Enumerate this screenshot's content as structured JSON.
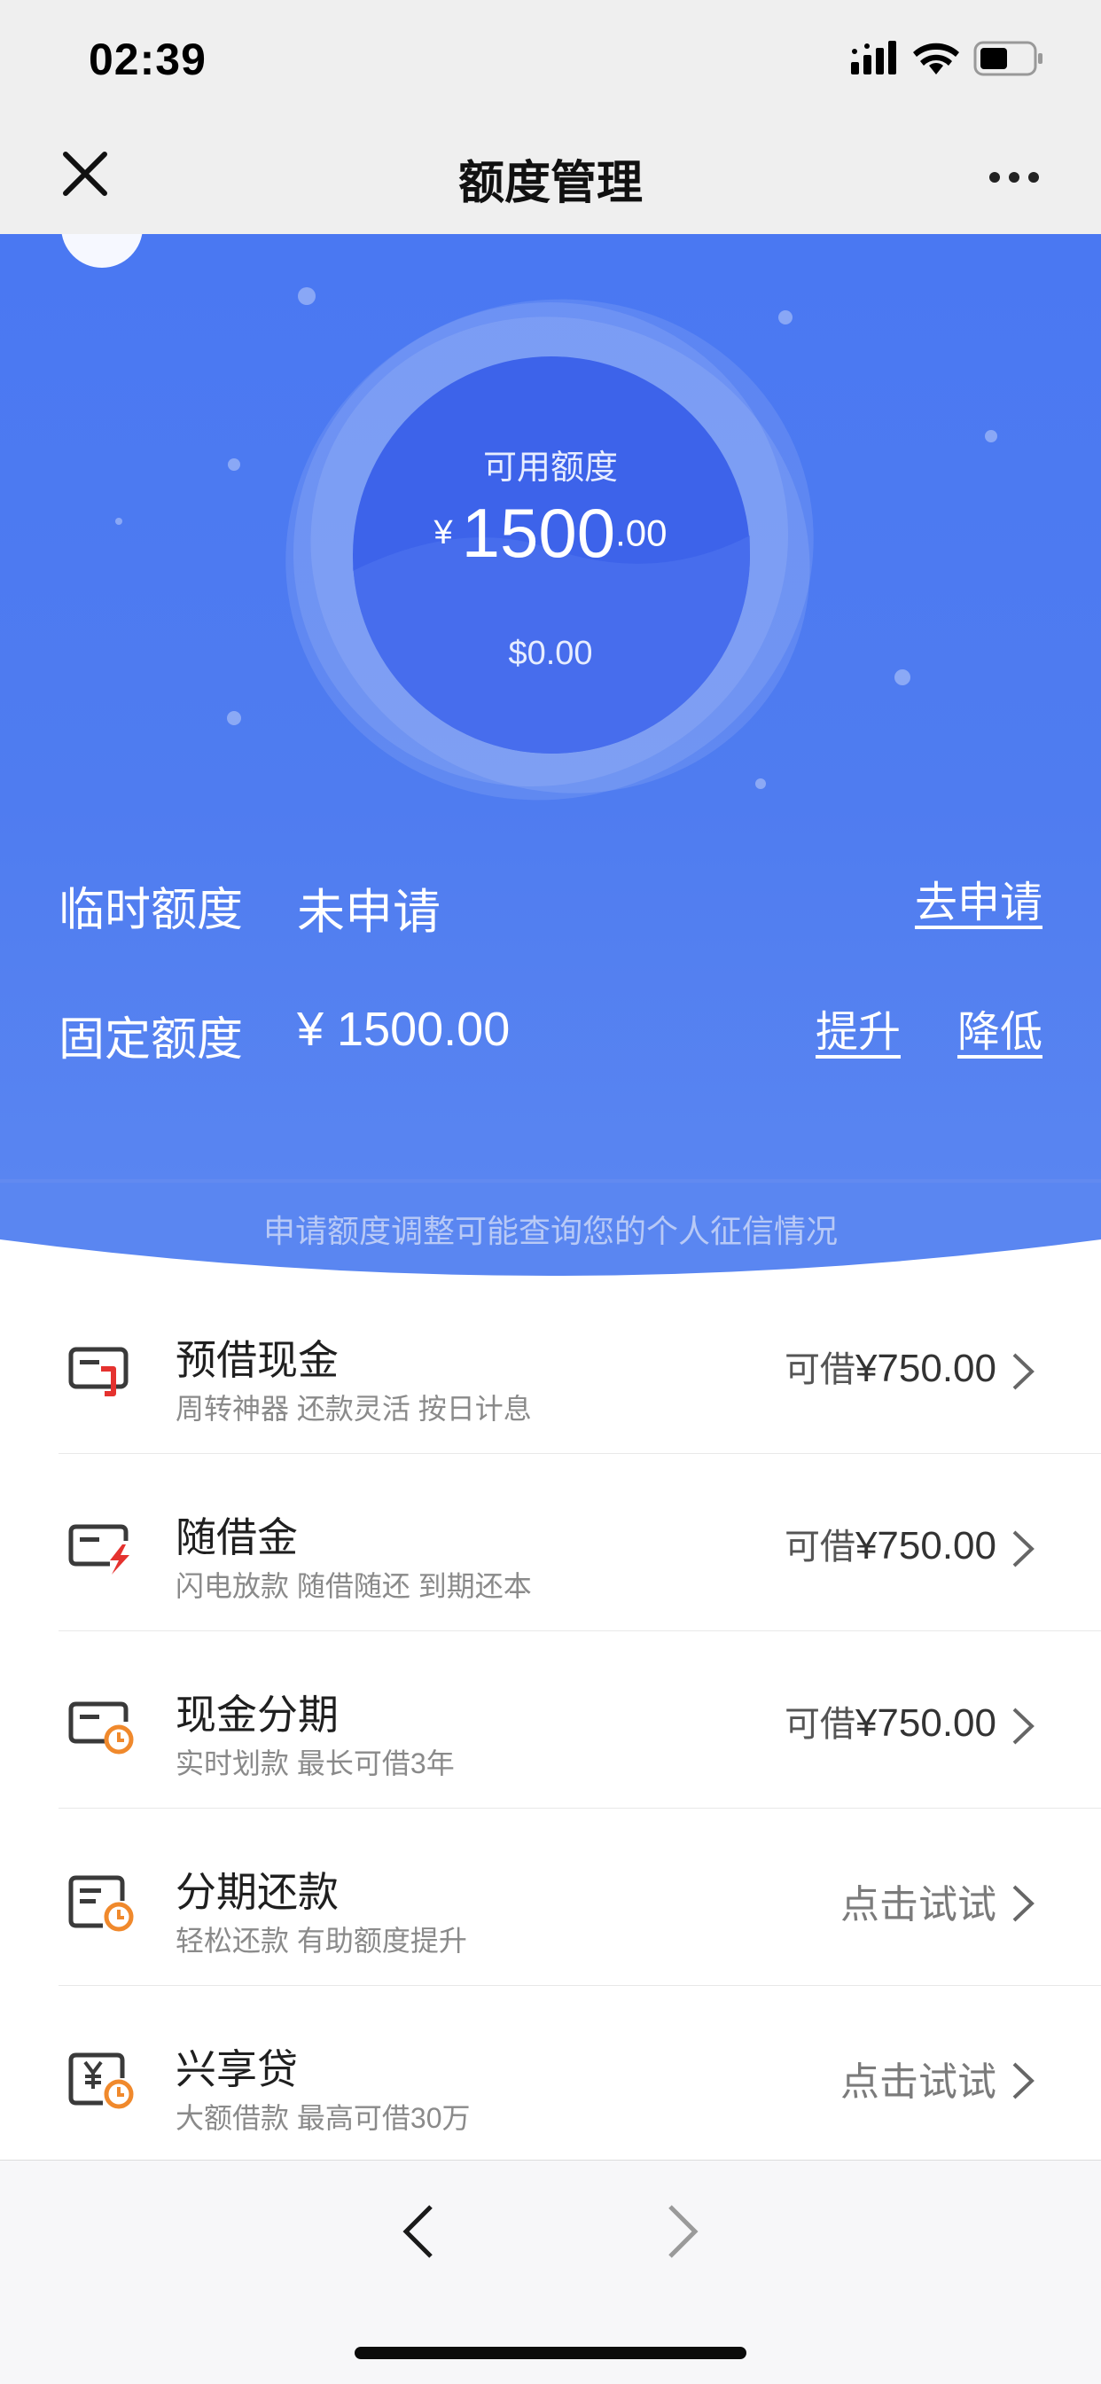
{
  "status_bar": {
    "time": "02:39"
  },
  "nav": {
    "title": "额度管理",
    "close_icon": "close-icon",
    "more_icon": "more-dots-icon"
  },
  "hero": {
    "available_label": "可用额度",
    "currency_symbol": "¥",
    "amount_integer": "1500",
    "amount_decimal": ".00",
    "usd_amount": "$0.00",
    "temp_quota": {
      "label": "临时额度",
      "value": "未申请",
      "action": "去申请"
    },
    "fixed_quota": {
      "label": "固定额度",
      "value": "¥ 1500.00",
      "raise": "提升",
      "lower": "降低"
    },
    "notice": "申请额度调整可能查询您的个人征信情况"
  },
  "products": [
    {
      "title": "预借现金",
      "subtitle": "周转神器 还款灵活 按日计息",
      "prefix": "可借",
      "amount": "¥750.00",
      "icon": "cash-advance-icon"
    },
    {
      "title": "随借金",
      "subtitle": "闪电放款 随借随还 到期还本",
      "prefix": "可借",
      "amount": "¥750.00",
      "icon": "flash-loan-icon"
    },
    {
      "title": "现金分期",
      "subtitle": "实时划款 最长可借3年",
      "prefix": "可借",
      "amount": "¥750.00",
      "icon": "cash-installment-icon"
    },
    {
      "title": "分期还款",
      "subtitle": "轻松还款 有助额度提升",
      "action": "点击试试",
      "icon": "installment-repay-icon"
    },
    {
      "title": "兴享贷",
      "subtitle": "大额借款 最高可借30万",
      "action": "点击试试",
      "icon": "large-loan-icon"
    }
  ],
  "colors": {
    "hero_blue": "#4a78f2",
    "accent_orange": "#f0892c",
    "accent_red": "#e5322f"
  }
}
